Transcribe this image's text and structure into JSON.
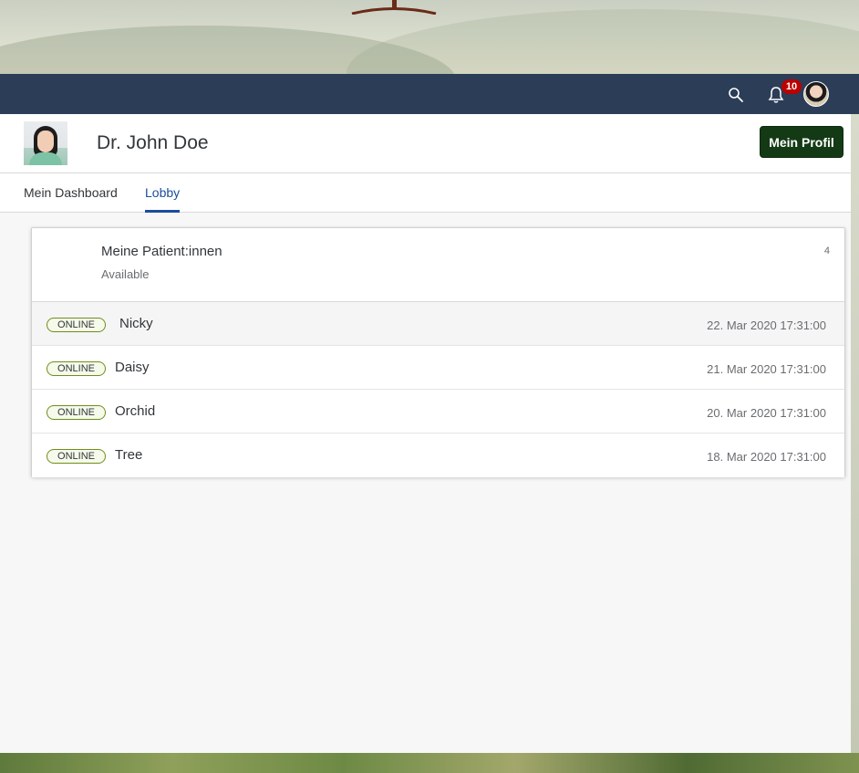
{
  "shell": {
    "notification_count": "10",
    "icons": [
      "search-icon",
      "bell-icon",
      "user-avatar"
    ]
  },
  "header": {
    "name": "Dr. John Doe",
    "profile_button": "Mein Profil"
  },
  "tabs": [
    {
      "label": "Mein Dashboard",
      "active": false
    },
    {
      "label": "Lobby",
      "active": true
    }
  ],
  "card": {
    "title": "Meine Patient:innen",
    "subtitle": "Available",
    "count": "4",
    "rows": [
      {
        "status": "ONLINE",
        "name": "Nicky",
        "date": "22. Mar 2020 17:31:00"
      },
      {
        "status": "ONLINE",
        "name": "Daisy",
        "date": "21. Mar 2020 17:31:00"
      },
      {
        "status": "ONLINE",
        "name": "Orchid",
        "date": "20. Mar 2020 17:31:00"
      },
      {
        "status": "ONLINE",
        "name": "Tree",
        "date": "18. Mar 2020 17:31:00"
      }
    ]
  },
  "colors": {
    "shell_bar": "#2b3d57",
    "primary_button": "#133a15",
    "badge": "#bb0000",
    "tab_active": "#1b4d9c",
    "status_border": "#6e8e1a"
  }
}
